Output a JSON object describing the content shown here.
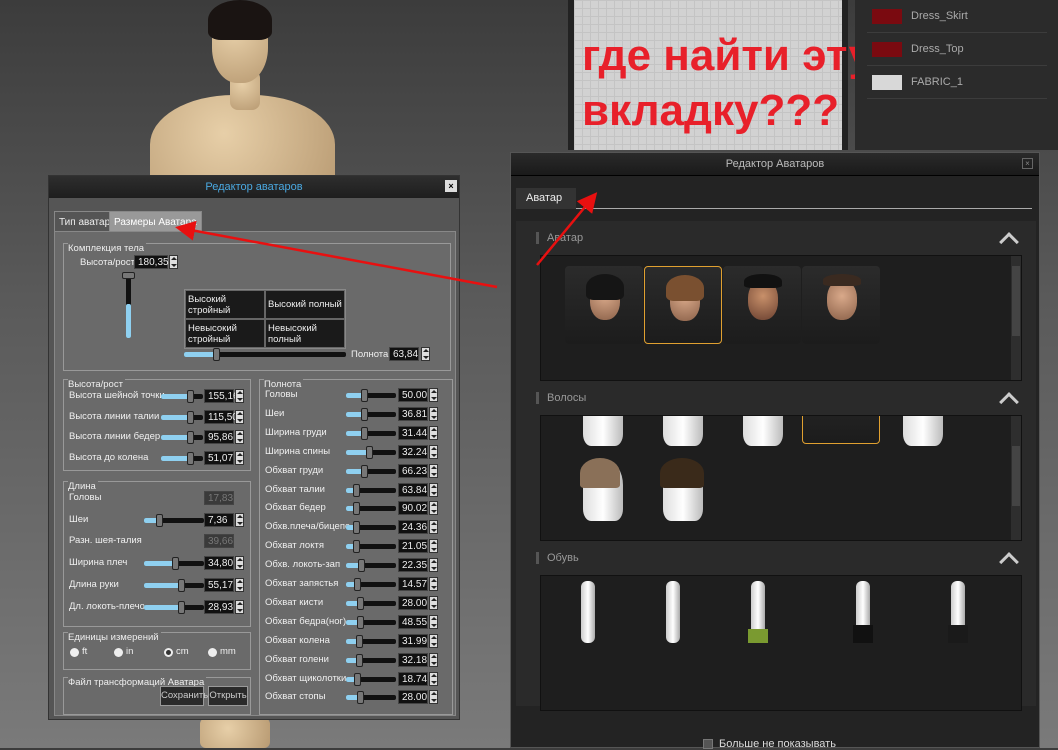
{
  "annotation": {
    "line1": "где найти эту",
    "line2": "вкладку???"
  },
  "fabrics": [
    {
      "name": "Dress_Skirt",
      "color": "#7a0a10"
    },
    {
      "name": "Dress_Top",
      "color": "#7a0a10"
    },
    {
      "name": "FABRIC_1",
      "color": "#d8d8d8"
    }
  ],
  "left_panel": {
    "title": "Редактор аватаров",
    "close": "×",
    "tabs": [
      "Тип аватара",
      "Размеры Аватара"
    ],
    "active_tab": 1,
    "body": {
      "group": "Комплекция тела",
      "height_label": "Высота/рост",
      "height_value": "180,35",
      "height_slider": 0.55,
      "table": [
        "Высокий стройный",
        "Высокий полный",
        "Невысокий стройный",
        "Невысокий полный"
      ],
      "fullness_label": "Полнота",
      "fullness_value": "63,84",
      "fullness_slider": 0.2
    },
    "height_group": {
      "title": "Высота/рост",
      "rows": [
        {
          "label": "Высота шейной точки",
          "value": "155,16",
          "fill": 0.7
        },
        {
          "label": "Высота линии талии",
          "value": "115,50",
          "fill": 0.7
        },
        {
          "label": "Высота линии бедер",
          "value": "95,86",
          "fill": 0.7
        },
        {
          "label": "Высота до колена",
          "value": "51,07",
          "fill": 0.7
        }
      ]
    },
    "length_group": {
      "title": "Длина",
      "rows": [
        {
          "label": "Головы",
          "value": "17,83",
          "readonly": true
        },
        {
          "label": "Шеи",
          "value": "7,36",
          "fill": 0.25
        },
        {
          "label": "Разн. шея-талия",
          "value": "39,66",
          "readonly": true
        },
        {
          "label": "Ширина плеч",
          "value": "34,80",
          "fill": 0.52
        },
        {
          "label": "Длина руки",
          "value": "55,17",
          "fill": 0.62
        },
        {
          "label": "Дл. локоть-плечо",
          "value": "28,93",
          "fill": 0.62
        }
      ]
    },
    "units": {
      "title": "Единицы измерений",
      "options": [
        "ft",
        "in",
        "cm",
        "mm"
      ],
      "selected": "cm"
    },
    "file": {
      "title": "Файл трансформаций Аватара",
      "save": "Сохранить",
      "open": "Открыть"
    },
    "fullness_group": {
      "title": "Полнота",
      "rows": [
        {
          "label": "Головы",
          "value": "50.00",
          "fill": 0.35
        },
        {
          "label": "Шеи",
          "value": "36.81",
          "fill": 0.35
        },
        {
          "label": "Ширина груди",
          "value": "31.44",
          "fill": 0.35
        },
        {
          "label": "Ширина спины",
          "value": "32.24",
          "fill": 0.45
        },
        {
          "label": "Обхват груди",
          "value": "66.23",
          "fill": 0.35
        },
        {
          "label": "Обхват талии",
          "value": "63.84",
          "fill": 0.2
        },
        {
          "label": "Обхват бедер",
          "value": "90.02",
          "fill": 0.2
        },
        {
          "label": "Обхв.плеча/бицепс",
          "value": "24.36",
          "fill": 0.2
        },
        {
          "label": "Обхват локтя",
          "value": "21.05",
          "fill": 0.2
        },
        {
          "label": "Обхв. локоть-зап",
          "value": "22.35",
          "fill": 0.3
        },
        {
          "label": "Обхват запястья",
          "value": "14.57",
          "fill": 0.22
        },
        {
          "label": "Обхват кисти",
          "value": "28.00",
          "fill": 0.28
        },
        {
          "label": "Обхват бедра(ног)",
          "value": "48.55",
          "fill": 0.28
        },
        {
          "label": "Обхват колена",
          "value": "31.99",
          "fill": 0.25
        },
        {
          "label": "Обхват голени",
          "value": "32.18",
          "fill": 0.25
        },
        {
          "label": "Обхват щиколотки",
          "value": "18.74",
          "fill": 0.22
        },
        {
          "label": "Обхват стопы",
          "value": "28.00",
          "fill": 0.28
        }
      ]
    }
  },
  "right_panel": {
    "title": "Редактор Аватаров",
    "close": "×",
    "tab": "Аватар",
    "sections": [
      "Аватар",
      "Волосы",
      "Обувь"
    ],
    "dont_show": "Больше не показывать"
  }
}
